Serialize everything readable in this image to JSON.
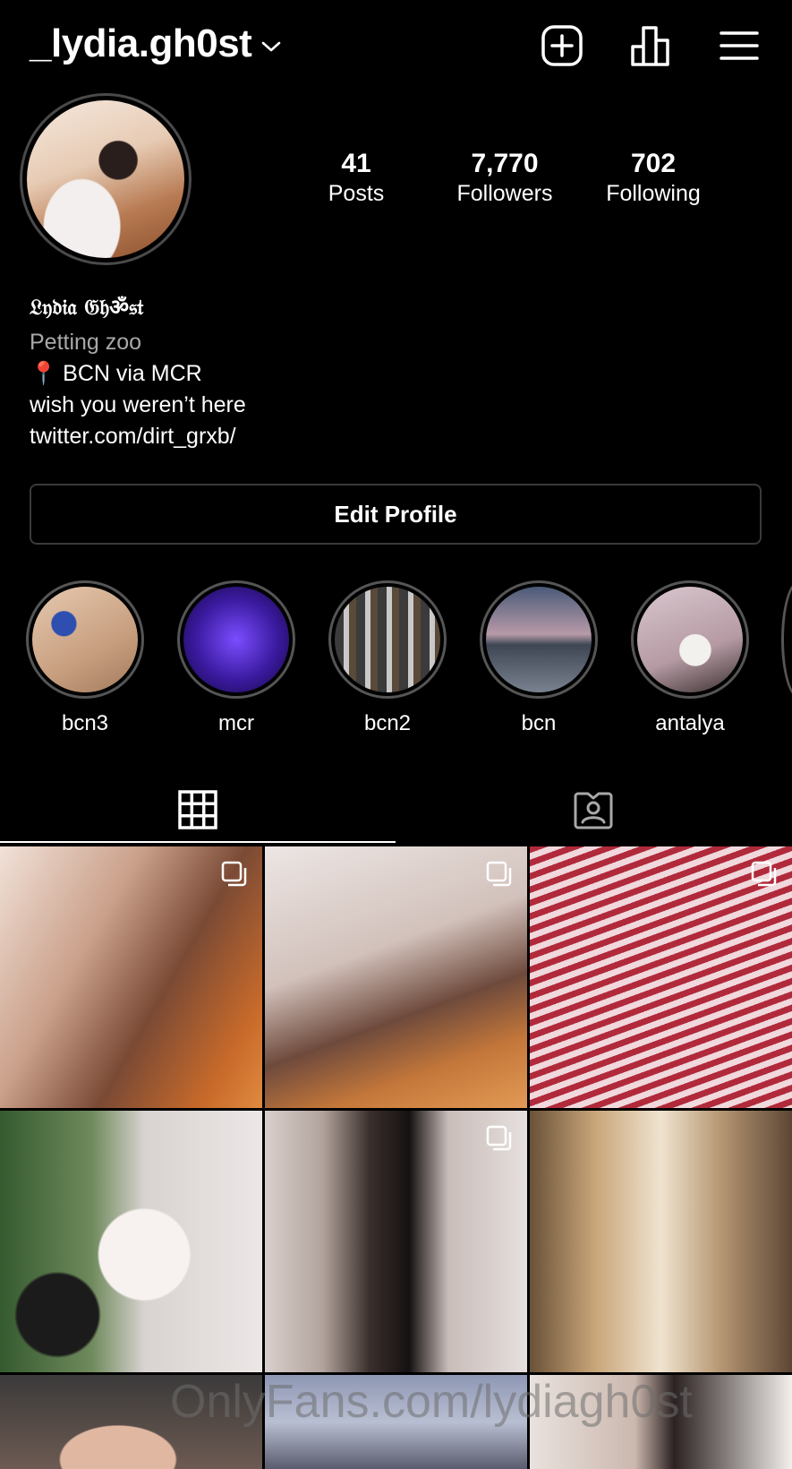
{
  "header": {
    "username": "_lydia.gh0st",
    "icons": [
      "chevron-down-icon",
      "new-post-icon",
      "insights-icon",
      "menu-icon"
    ]
  },
  "profile": {
    "stats": [
      {
        "value": "41",
        "label": "Posts"
      },
      {
        "value": "7,770",
        "label": "Followers"
      },
      {
        "value": "702",
        "label": "Following"
      }
    ],
    "display_name": "𝔏𝔶𝔡𝔦𝔞 𝔊𝔥ॐ𝔰𝔱",
    "bio": {
      "category": "Petting zoo",
      "location_pin": "📍",
      "location": "BCN via MCR",
      "line": "wish you weren’t here",
      "link": "twitter.com/dirt_grxb/"
    },
    "edit_profile_label": "Edit Profile"
  },
  "highlights": [
    {
      "label": "bcn3"
    },
    {
      "label": "mcr"
    },
    {
      "label": "bcn2"
    },
    {
      "label": "bcn"
    },
    {
      "label": "antalya"
    }
  ],
  "tabs": [
    {
      "name": "posts",
      "icon": "grid-icon",
      "active": true
    },
    {
      "name": "tagged",
      "icon": "tagged-icon",
      "active": false
    }
  ],
  "watermark": "OnlyFans.com/lydiagh0st",
  "colors": {
    "background": "#000000",
    "secondary_text": "#a8a8a8",
    "border": "#3a3a3a"
  }
}
